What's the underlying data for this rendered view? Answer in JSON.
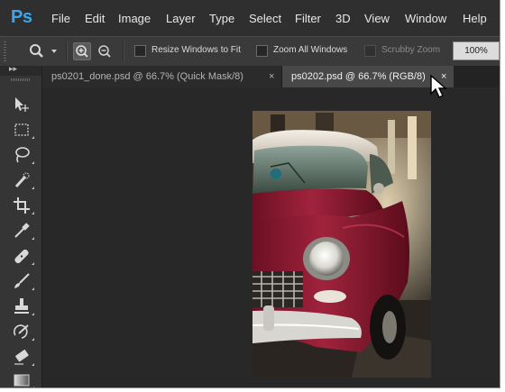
{
  "app": {
    "logo": "Ps"
  },
  "menu": {
    "items": [
      {
        "label": "File"
      },
      {
        "label": "Edit"
      },
      {
        "label": "Image"
      },
      {
        "label": "Layer"
      },
      {
        "label": "Type"
      },
      {
        "label": "Select"
      },
      {
        "label": "Filter"
      },
      {
        "label": "3D"
      },
      {
        "label": "View"
      },
      {
        "label": "Window"
      },
      {
        "label": "Help"
      }
    ]
  },
  "options": {
    "resize_windows": {
      "label": "Resize Windows to Fit",
      "checked": false
    },
    "zoom_all": {
      "label": "Zoom All Windows",
      "checked": false
    },
    "scrubby_zoom": {
      "label": "Scrubby Zoom",
      "checked": false,
      "disabled": true
    },
    "zoom_value": "100%"
  },
  "tabs": [
    {
      "label": "ps0201_done.psd @ 66.7% (Quick Mask/8)",
      "close": "×",
      "active": false
    },
    {
      "label": "ps0202.psd @ 66.7% (RGB/8)",
      "close": "×",
      "active": true
    }
  ],
  "toolbar": {
    "collapse_glyph": "▸▸",
    "tools": [
      {
        "icon": "move-tool-icon"
      },
      {
        "icon": "marquee-tool-icon"
      },
      {
        "icon": "lasso-tool-icon"
      },
      {
        "icon": "quick-select-tool-icon"
      },
      {
        "icon": "crop-tool-icon"
      },
      {
        "icon": "eyedropper-tool-icon"
      },
      {
        "icon": "healing-brush-tool-icon"
      },
      {
        "icon": "brush-tool-icon"
      },
      {
        "icon": "clone-stamp-tool-icon"
      },
      {
        "icon": "history-brush-tool-icon"
      },
      {
        "icon": "eraser-tool-icon"
      },
      {
        "icon": "gradient-tool-icon"
      }
    ]
  },
  "colors": {
    "logo_blue": "#3ea6e8",
    "ui_bg": "#282828",
    "panel_bg": "#353535",
    "active_tab_bg": "#484848",
    "car_body": "#8a1730"
  },
  "document": {
    "subject": "vintage-red-car-photo"
  }
}
